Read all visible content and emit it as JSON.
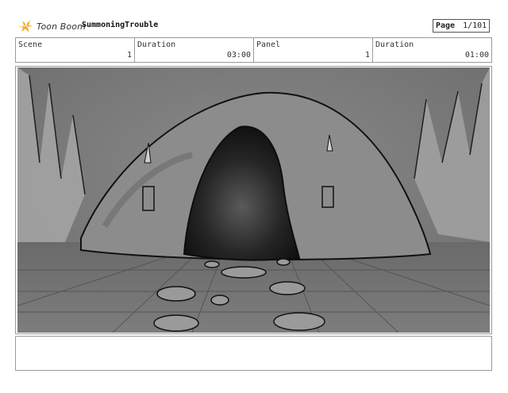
{
  "header": {
    "brand": "Toon Boom",
    "project_title": "SummoningTrouble",
    "page_label": "Page",
    "page_value": "1/101"
  },
  "info": {
    "scene_label": "Scene",
    "scene_value": "1",
    "scene_duration_label": "Duration",
    "scene_duration_value": "03:00",
    "panel_label": "Panel",
    "panel_value": "1",
    "panel_duration_label": "Duration",
    "panel_duration_value": "01:00"
  },
  "colors": {
    "logo_accent": "#f2a81d",
    "frame_border": "#9a9a9a"
  },
  "icons": [
    "toon-boom-logo-icon"
  ]
}
